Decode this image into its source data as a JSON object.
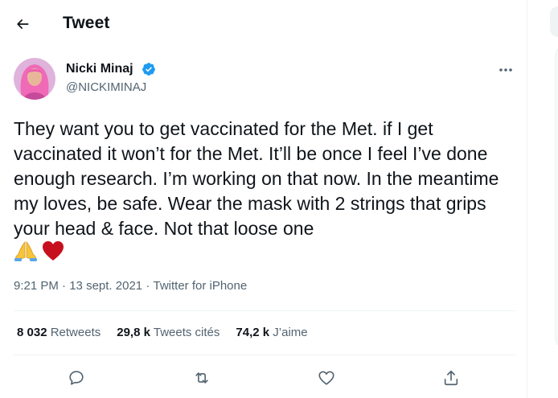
{
  "header": {
    "back_icon": "arrow-left-icon",
    "title": "Tweet"
  },
  "author": {
    "name": "Nicki Minaj",
    "handle": "@NICKIMINAJ",
    "verified": true,
    "verified_color": "#1d9bf0"
  },
  "tweet": {
    "text": "They want you to get vaccinated for the Met. if I get vaccinated it won’t for the Met. It’ll be once I feel I’ve done enough research. I’m working on that now. In the meantime my loves, be safe. Wear the mask with 2 strings that grips your head & face. Not that loose one",
    "emojis": [
      "praying-hands-emoji",
      "red-heart-emoji"
    ]
  },
  "meta": {
    "time": "9:21 PM",
    "separator": "·",
    "date": "13 sept. 2021",
    "source": "Twitter for iPhone"
  },
  "stats": {
    "retweets_count": "8 032",
    "retweets_label": "Retweets",
    "quotes_count": "29,8 k",
    "quotes_label": "Tweets cités",
    "likes_count": "74,2 k",
    "likes_label": "J’aime"
  },
  "actions": {
    "reply_icon": "reply-icon",
    "retweet_icon": "retweet-icon",
    "like_icon": "heart-icon",
    "share_icon": "share-icon"
  },
  "colors": {
    "text": "#0f1419",
    "secondary": "#536471",
    "divider": "#eff3f4",
    "accent": "#1d9bf0"
  }
}
